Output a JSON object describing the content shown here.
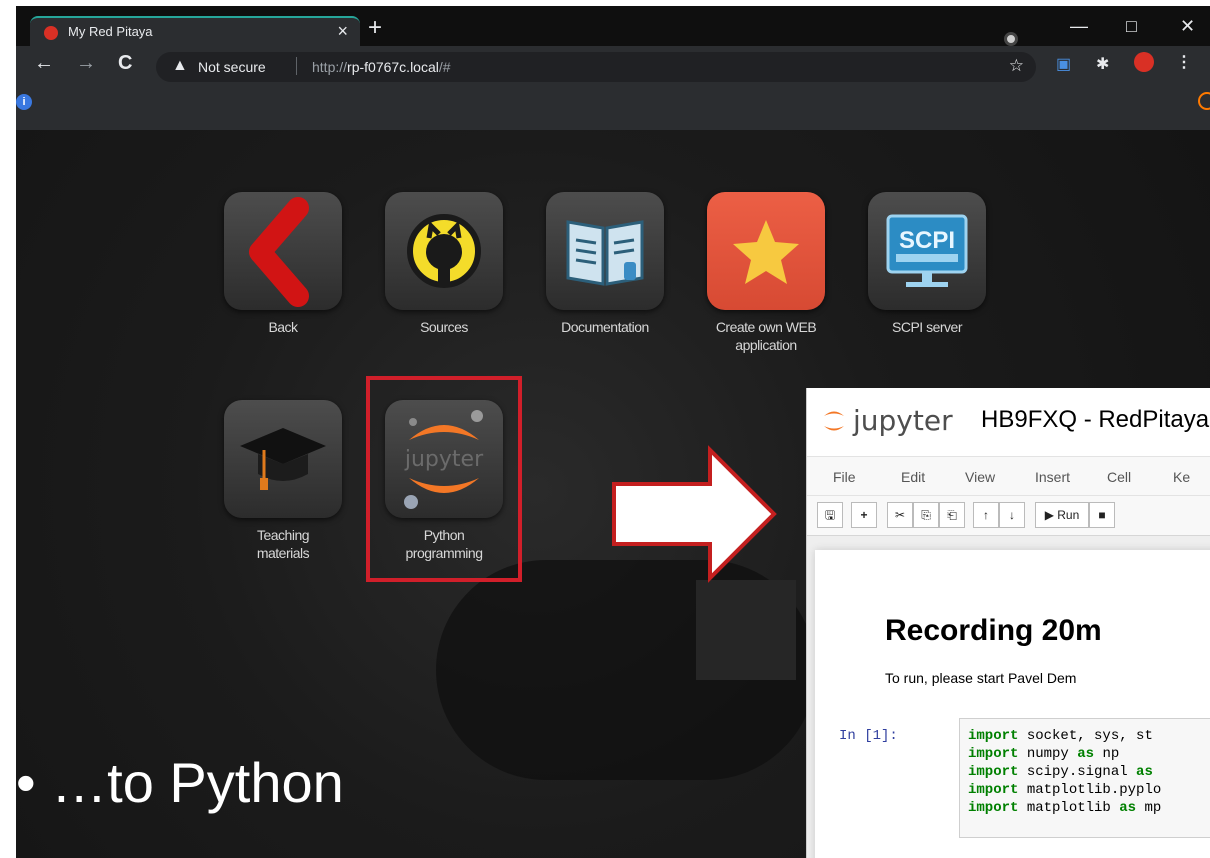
{
  "browser": {
    "tab_title": "My Red Pitaya",
    "tab_close": "×",
    "new_tab": "+",
    "window_controls": [
      "—",
      "□",
      "✕"
    ],
    "nav": {
      "back": "←",
      "forward": "→",
      "reload": "C"
    },
    "security_label": "Not secure",
    "url_scheme": "http://",
    "url_host": "rp-f0767c.local",
    "url_path": "/#"
  },
  "apps": [
    {
      "label": "Back",
      "icon": "back-chevron-icon"
    },
    {
      "label": "Sources",
      "icon": "github-icon"
    },
    {
      "label": "Documentation",
      "icon": "book-icon"
    },
    {
      "label": "Create own WEB application",
      "icon": "star-icon"
    },
    {
      "label": "SCPI server",
      "icon": "scpi-monitor-icon"
    },
    {
      "label": "Teaching materials",
      "icon": "graduation-cap-icon"
    },
    {
      "label": "Python programming",
      "icon": "jupyter-icon"
    }
  ],
  "scpi_icon_text": "SCPI",
  "jupyter_icon_text": "jupyter",
  "slide_caption": "• …to Python",
  "jupyter": {
    "wordmark": "jupyter",
    "notebook_title": "HB9FXQ - RedPitaya",
    "menu": [
      "File",
      "Edit",
      "View",
      "Insert",
      "Cell",
      "Ke"
    ],
    "toolbar": [
      "🖫",
      "+",
      "✂",
      "⎘",
      "⎗",
      "↑",
      "↓",
      "▶ Run",
      "■"
    ],
    "heading": "Recording 20m",
    "paragraph": "To run, please start Pavel Dem",
    "prompt": "In [1]:",
    "code": [
      {
        "kw": "import",
        "rest": " socket, sys, st"
      },
      {
        "kw": "import",
        "rest": " numpy ",
        "kw2": "as",
        "rest2": " np"
      },
      {
        "kw": "import",
        "rest": " scipy.signal ",
        "kw2": "as",
        "rest2": ""
      },
      {
        "kw": "import",
        "rest": " matplotlib.pyplo"
      },
      {
        "kw": "import",
        "rest": " matplotlib ",
        "kw2": "as",
        "rest2": " mp"
      }
    ]
  },
  "colors": {
    "highlight": "#d11f2a",
    "tab_accent": "#26a69a",
    "create_tile": "#e5553d"
  }
}
